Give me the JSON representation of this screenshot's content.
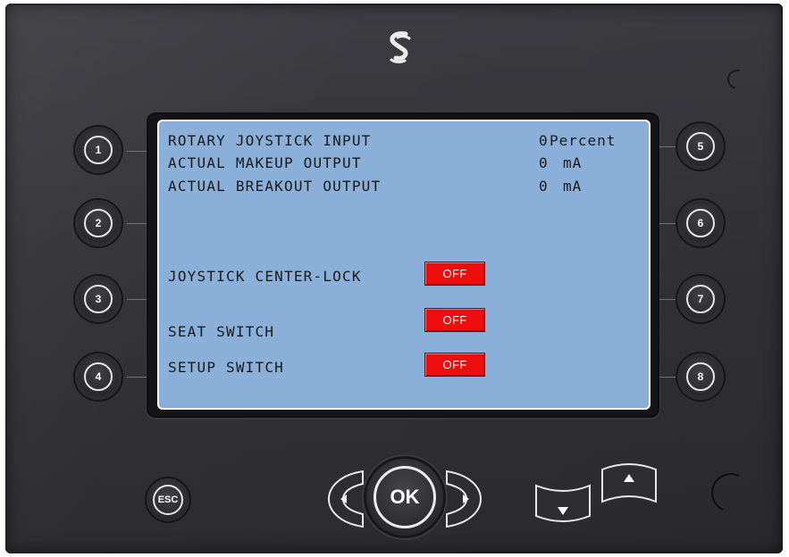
{
  "brand": {
    "logo_icon": "s-brand-logo-icon"
  },
  "screen": {
    "lines": [
      {
        "label": "ROTARY JOYSTICK INPUT",
        "value": "0",
        "unit": "Percent"
      },
      {
        "label": "ACTUAL MAKEUP OUTPUT",
        "value": "0",
        "unit": "mA"
      },
      {
        "label": "ACTUAL BREAKOUT OUTPUT",
        "value": "0",
        "unit": "mA"
      }
    ],
    "indicators": [
      {
        "label": "JOYSTICK CENTER-LOCK",
        "state": "OFF"
      },
      {
        "label": "SEAT SWITCH",
        "state": "OFF"
      },
      {
        "label": "SETUP SWITCH",
        "state": "OFF"
      }
    ],
    "colors": {
      "background": "#8aafd8",
      "indicator_off": "#ee0d0d",
      "text": "#1a1a1a"
    }
  },
  "softkeys": {
    "left": [
      "1",
      "2",
      "3",
      "4"
    ],
    "right": [
      "5",
      "6",
      "7",
      "8"
    ]
  },
  "nav": {
    "esc_label": "ESC",
    "ok_label": "OK",
    "left_icon": "arrow-left-icon",
    "right_icon": "arrow-right-icon",
    "down_icon": "arrow-down-icon",
    "up_icon": "arrow-up-icon"
  }
}
